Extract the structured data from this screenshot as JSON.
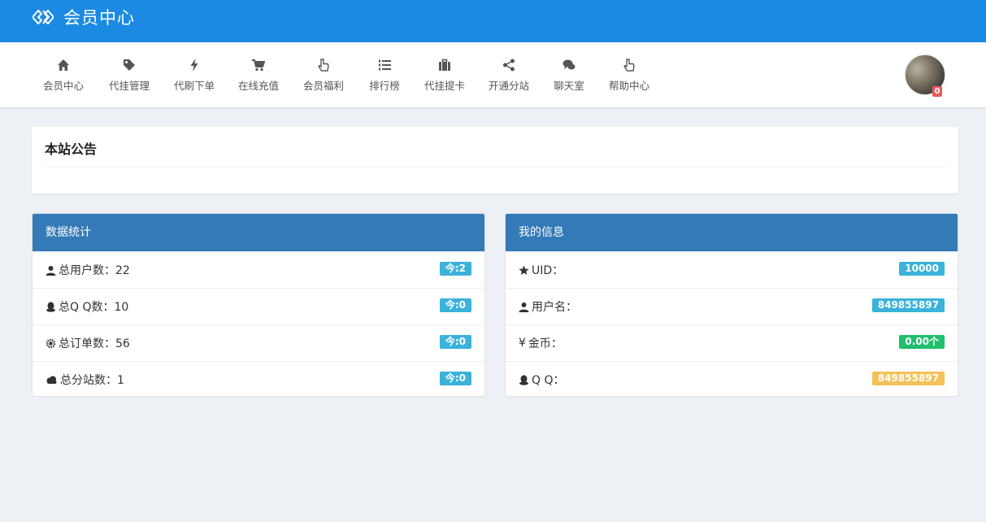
{
  "header": {
    "title": "会员中心"
  },
  "nav": [
    {
      "label": "会员中心",
      "icon": "home-icon"
    },
    {
      "label": "代挂管理",
      "icon": "tag-icon"
    },
    {
      "label": "代刷下单",
      "icon": "bolt-icon"
    },
    {
      "label": "在线充值",
      "icon": "cart-icon"
    },
    {
      "label": "会员福利",
      "icon": "hand-pointer-icon"
    },
    {
      "label": "排行榜",
      "icon": "list-ordered-icon"
    },
    {
      "label": "代挂提卡",
      "icon": "briefcase-icon"
    },
    {
      "label": "开通分站",
      "icon": "share-icon"
    },
    {
      "label": "聊天室",
      "icon": "comments-icon"
    },
    {
      "label": "帮助中心",
      "icon": "hand-pointer-icon"
    }
  ],
  "user": {
    "badge_count": "0"
  },
  "notice": {
    "title": "本站公告"
  },
  "stats": {
    "title": "数据统计",
    "rows": [
      {
        "label": "总用户数：22",
        "badge": "今:2",
        "icon": "user-icon"
      },
      {
        "label": "总Q Q数：10",
        "badge": "今:0",
        "icon": "qq-icon"
      },
      {
        "label": "总订单数：56",
        "badge": "今:0",
        "icon": "gear-icon"
      },
      {
        "label": "总分站数：1",
        "badge": "今:0",
        "icon": "cloud-icon"
      }
    ]
  },
  "info": {
    "title": "我的信息",
    "rows": [
      {
        "label": "UID：",
        "badge": "10000",
        "icon": "star-icon"
      },
      {
        "label": "用户名：",
        "badge": "849855897",
        "icon": "user-icon"
      },
      {
        "label": "金币：",
        "badge": "0.00个",
        "icon": "yen-icon",
        "icon_glyph": "¥"
      },
      {
        "label": "Q Q：",
        "badge": "849855897",
        "icon": "qq-icon"
      }
    ]
  },
  "colors": {
    "topbar": "#1b8ae2",
    "panel_head": "#337ab7",
    "info": "#3bb2da",
    "success": "#1fbf6c",
    "warning": "#f5c15a"
  }
}
